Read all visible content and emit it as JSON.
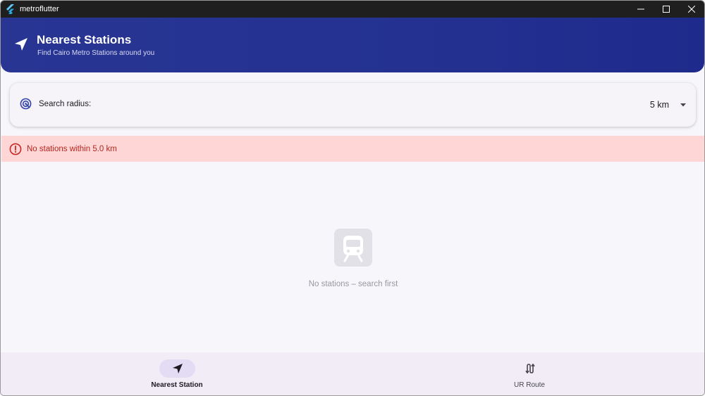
{
  "window": {
    "title": "metroflutter",
    "controls": [
      "minimize-icon",
      "maximize-icon",
      "close-icon"
    ]
  },
  "header": {
    "icon": "navigation-arrow-icon",
    "title": "Nearest Stations",
    "subtitle": "Find Cairo Metro Stations around you"
  },
  "search": {
    "icon": "radar-icon",
    "label": "Search radius:",
    "value": "5 km"
  },
  "banner": {
    "icon": "error-circle-icon",
    "text": "No stations within 5.0 km"
  },
  "empty_state": {
    "icon": "train-icon",
    "text": "No stations – search first"
  },
  "bottom_nav": {
    "items": [
      {
        "label": "Nearest Station",
        "icon": "navigation-arrow-icon",
        "active": true
      },
      {
        "label": "UR Route",
        "icon": "route-icon",
        "active": false
      }
    ]
  },
  "colors": {
    "header": "#283593",
    "banner_bg": "#ffd6d6",
    "error": "#b3261e",
    "nav_active_pill": "#e3dcf4"
  }
}
